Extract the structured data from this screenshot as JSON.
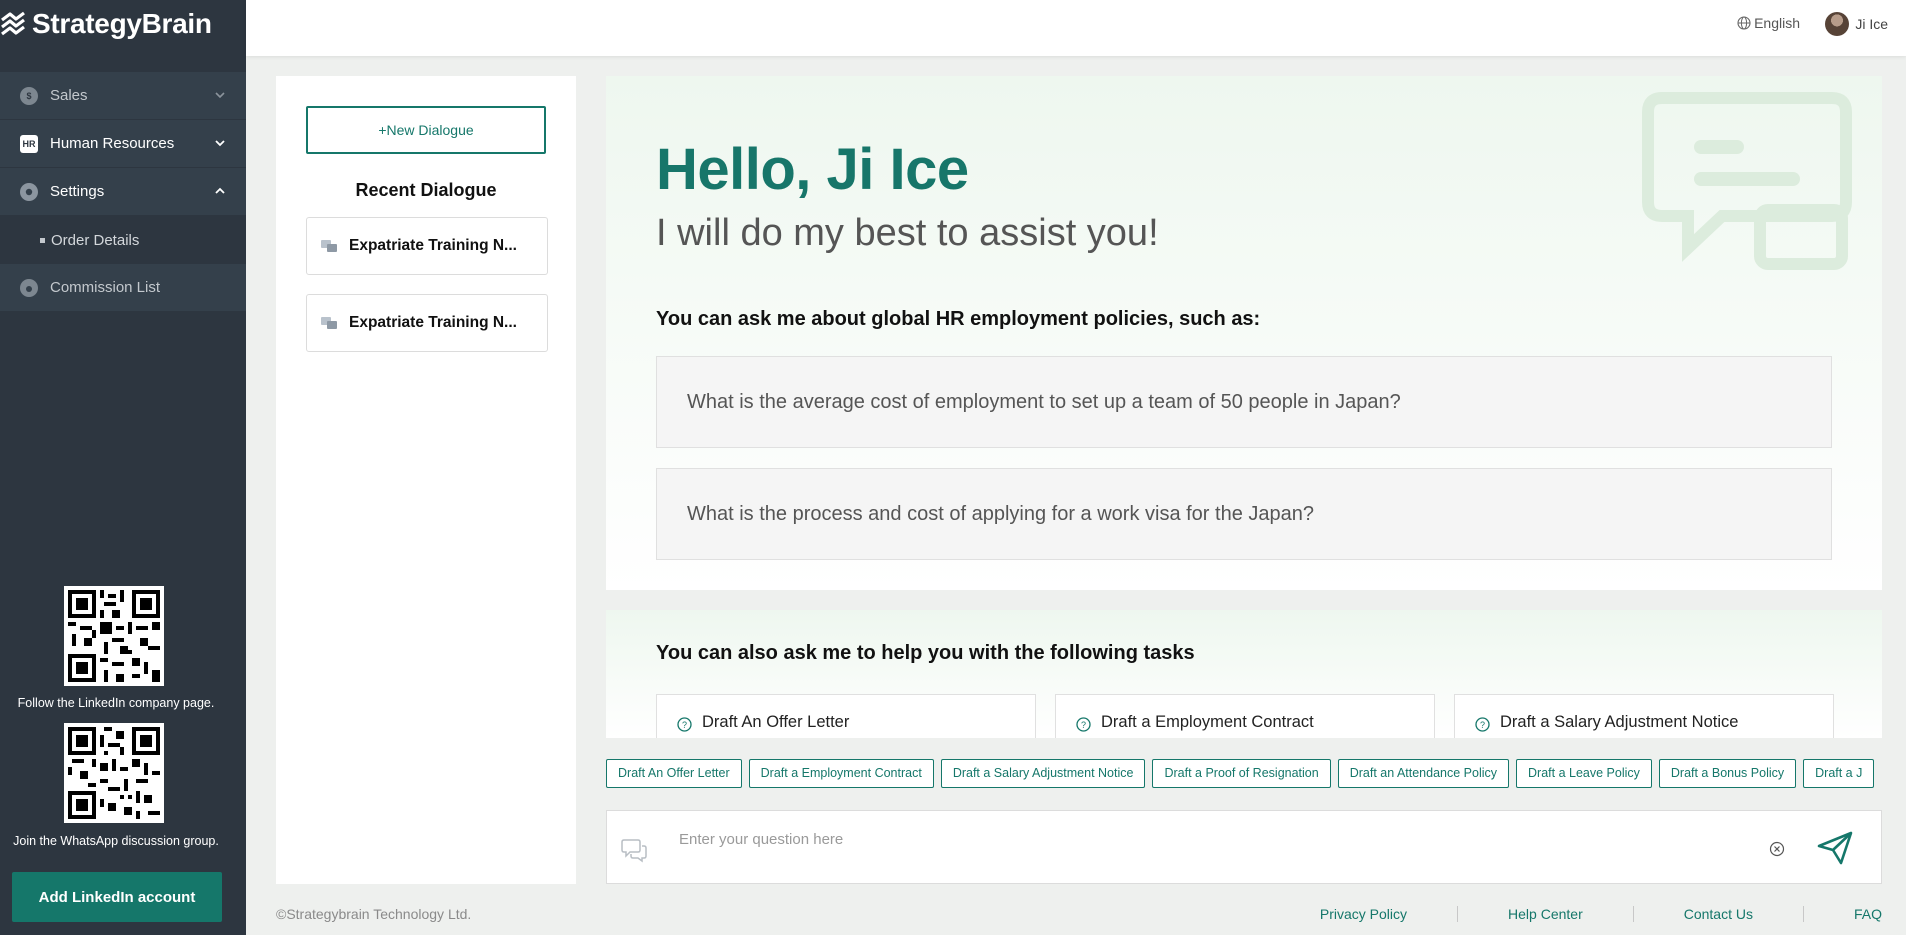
{
  "brand": {
    "name": "StrategyBrain",
    "accent": "#15776a",
    "sidebar_bg": "#2d3640"
  },
  "sidebar": {
    "menu": [
      {
        "label": "Sales",
        "icon": "sales-icon",
        "state": "collapsed"
      },
      {
        "label": "Human Resources",
        "icon": "hr-icon",
        "state": "collapsed"
      },
      {
        "label": "Settings",
        "icon": "gear-icon",
        "state": "expanded"
      }
    ],
    "settings_sub": [
      {
        "label": "Order Details"
      }
    ],
    "commission": {
      "label": "Commission List",
      "icon": "commission-icon"
    },
    "qr_linkedin_caption": "Follow the LinkedIn company page.",
    "qr_whatsapp_caption": "Join the WhatsApp discussion group.",
    "add_linkedin_label": "Add LinkedIn account"
  },
  "topbar": {
    "language": "English",
    "user_name": "Ji Ice"
  },
  "dialogue_panel": {
    "new_dialogue_label": "+New Dialogue",
    "recent_title": "Recent Dialogue",
    "items": [
      {
        "title": "Expatriate Training N..."
      },
      {
        "title": "Expatriate Training N..."
      }
    ]
  },
  "greeting": {
    "hello": "Hello, Ji Ice",
    "subtitle": "I will do my best to assist you!",
    "ask_title": "You can ask me about global HR employment policies, such as:",
    "questions": [
      "What is the average cost of employment to set up a team of 50 people in Japan?",
      "What is the process and cost of applying for a work visa for the Japan?"
    ]
  },
  "tasks": {
    "title": "You can also ask me to help you with the following tasks",
    "cards": [
      "Draft An Offer Letter",
      "Draft a Employment Contract",
      "Draft a Salary Adjustment Notice"
    ]
  },
  "chips": [
    "Draft An Offer Letter",
    "Draft a Employment Contract",
    "Draft a Salary Adjustment Notice",
    "Draft a Proof of Resignation",
    "Draft an Attendance Policy",
    "Draft a Leave Policy",
    "Draft a Bonus Policy",
    "Draft a J"
  ],
  "input": {
    "placeholder": "Enter your question here"
  },
  "footer": {
    "copyright": "©Strategybrain Technology Ltd.",
    "links": [
      "Privacy Policy",
      "Help Center",
      "Contact Us",
      "FAQ"
    ]
  }
}
